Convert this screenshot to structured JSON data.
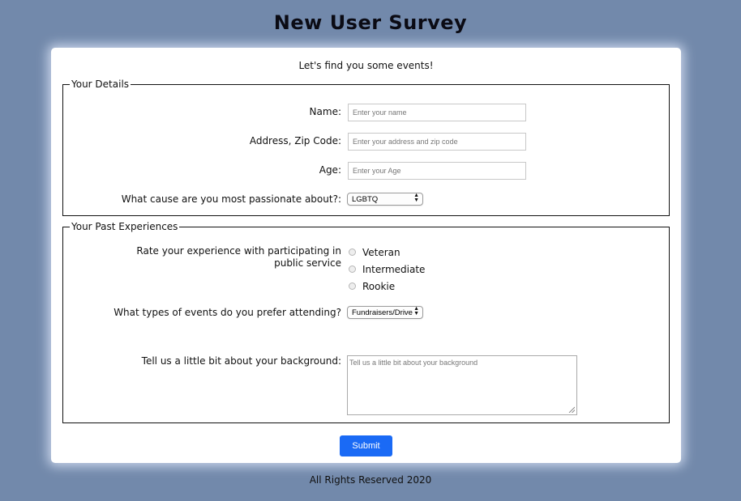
{
  "title": "New User Survey",
  "intro": "Let's find you some events!",
  "details": {
    "legend": "Your Details",
    "name": {
      "label": "Name:",
      "placeholder": "Enter your name"
    },
    "address": {
      "label": "Address, Zip Code:",
      "placeholder": "Enter your address and zip code"
    },
    "age": {
      "label": "Age:",
      "placeholder": "Enter your Age"
    },
    "cause": {
      "label": "What cause are you most passionate about?:",
      "selected": "LGBTQ"
    }
  },
  "past": {
    "legend": "Your Past Experiences",
    "rating_label": "Rate your experience with participating in public service",
    "rating_options": [
      "Veteran",
      "Intermediate",
      "Rookie"
    ],
    "events_label": "What types of events do you prefer attending?",
    "events_selected": "Fundraisers/Drive",
    "background_label": "Tell us a little bit about your background:",
    "background_placeholder": "Tell us a little bit about your background"
  },
  "submit_label": "Submit",
  "footer": "All Rights Reserved 2020",
  "colors": {
    "background": "#7289ab",
    "card": "#ffffff",
    "submit": "#1a6af5"
  },
  "icons": {
    "select_arrows": "updown-arrows-icon",
    "resize": "resize-grip-icon"
  }
}
